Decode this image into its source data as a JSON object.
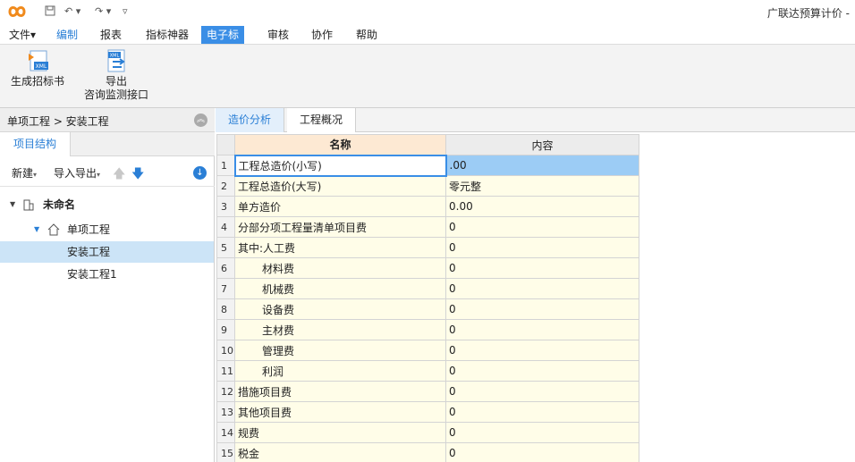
{
  "titlebar": {
    "app_title": "广联达预算计价 -"
  },
  "menu": {
    "items": [
      "文件▾",
      "编制",
      "报表",
      "指标神器",
      "电子标",
      "审核",
      "协作",
      "帮助"
    ]
  },
  "ribbon": {
    "generate_label": "生成招标书",
    "export_line1": "导出",
    "export_line2": "咨询监测接口"
  },
  "left": {
    "breadcrumb": "单项工程 > 安装工程",
    "tab": "项目结构",
    "new_label": "新建",
    "import_label": "导入导出",
    "tree": {
      "root": "未命名",
      "single": "单项工程",
      "item1": "安装工程",
      "item2": "安装工程1"
    }
  },
  "right": {
    "tabs": [
      "造价分析",
      "工程概况"
    ],
    "columns": [
      "名称",
      "内容"
    ],
    "rows": [
      {
        "n": "1",
        "name": "工程总造价(小写)",
        "value": ".00"
      },
      {
        "n": "2",
        "name": "工程总造价(大写)",
        "value": "零元整"
      },
      {
        "n": "3",
        "name": "单方造价",
        "value": "0.00"
      },
      {
        "n": "4",
        "name": "分部分项工程量清单项目费",
        "value": "0"
      },
      {
        "n": "5",
        "name": "其中:人工费",
        "value": "0"
      },
      {
        "n": "6",
        "name": "材料费",
        "value": "0"
      },
      {
        "n": "7",
        "name": "机械费",
        "value": "0"
      },
      {
        "n": "8",
        "name": "设备费",
        "value": "0"
      },
      {
        "n": "9",
        "name": "主材费",
        "value": "0"
      },
      {
        "n": "10",
        "name": "管理费",
        "value": "0"
      },
      {
        "n": "11",
        "name": "利润",
        "value": "0"
      },
      {
        "n": "12",
        "name": "措施项目费",
        "value": "0"
      },
      {
        "n": "13",
        "name": "其他项目费",
        "value": "0"
      },
      {
        "n": "14",
        "name": "规费",
        "value": "0"
      },
      {
        "n": "15",
        "name": "税金",
        "value": "0"
      }
    ]
  }
}
